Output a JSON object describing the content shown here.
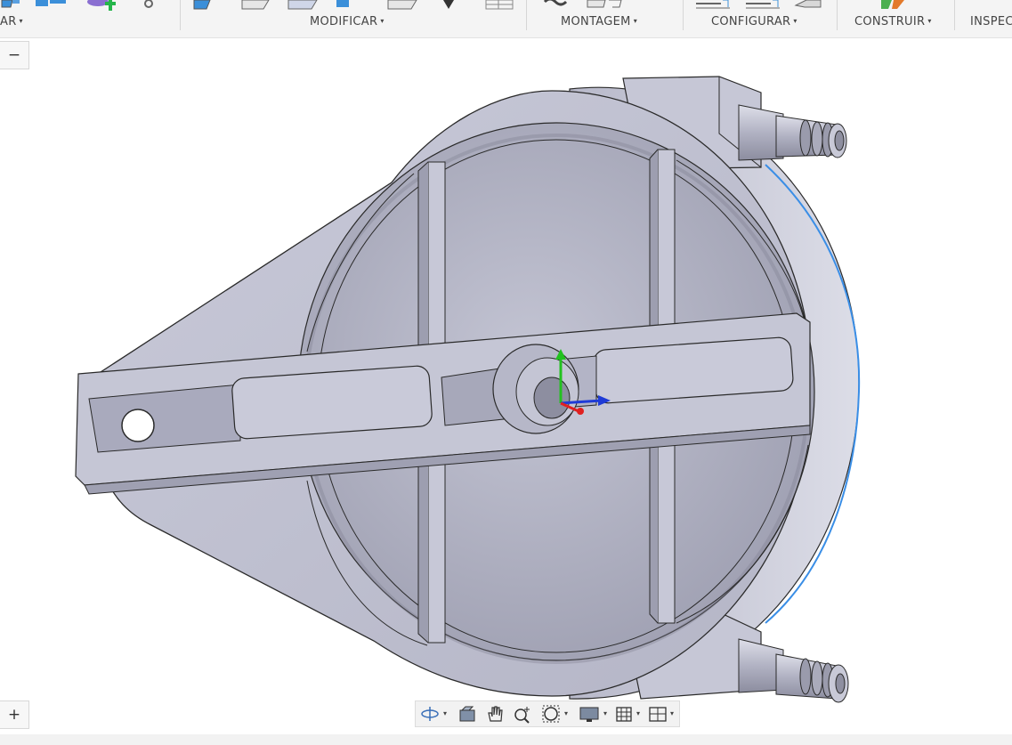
{
  "toolbar": {
    "groups": [
      {
        "label": "AR",
        "full_label": "CRIAR"
      },
      {
        "label": "MODIFICAR"
      },
      {
        "label": "MONTAGEM"
      },
      {
        "label": "CONFIGURAR"
      },
      {
        "label": "CONSTRUIR"
      },
      {
        "label": "INSPEC"
      }
    ],
    "caret": "▾"
  },
  "side_controls": {
    "collapse_label": "−",
    "expand_label": "+"
  },
  "viewport": {
    "model": "3d-part-housing",
    "axes": {
      "x_color": "#1f3bd6",
      "y_color": "#22c11f",
      "z_color": "#e02020"
    }
  },
  "navbar": {
    "items": [
      {
        "icon": "orbit-icon",
        "has_dropdown": true
      },
      {
        "icon": "look-at-icon",
        "has_dropdown": false
      },
      {
        "icon": "pan-hand-icon",
        "has_dropdown": false
      },
      {
        "icon": "zoom-icon",
        "has_dropdown": false
      },
      {
        "icon": "fit-window-icon",
        "has_dropdown": true
      },
      {
        "icon": "display-settings-icon",
        "has_dropdown": true
      },
      {
        "icon": "grid-icon",
        "has_dropdown": true
      },
      {
        "icon": "viewports-icon",
        "has_dropdown": true
      }
    ]
  },
  "colors": {
    "part_face": "#c3c4d4",
    "part_shadow": "#9a9bad",
    "edge": "#2a2a2a",
    "selection": "#3a8ee6"
  }
}
